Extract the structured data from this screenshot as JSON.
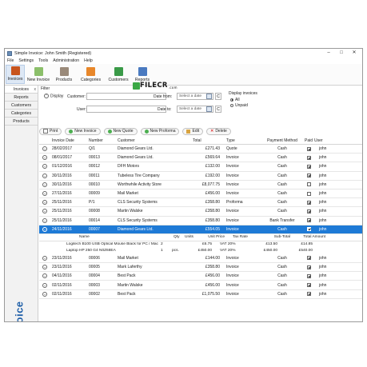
{
  "window": {
    "title": "Simple Invoice: John Smith (Registered)",
    "minimize": "–",
    "maximize": "□",
    "close": "✕"
  },
  "menu": [
    "File",
    "Settings",
    "Tools",
    "Administration",
    "Help"
  ],
  "ribbon": [
    {
      "label": "Invoices",
      "icon": "invoices-icon",
      "color": "#c8551e"
    },
    {
      "label": "New Invoice",
      "icon": "new-invoice-icon",
      "color": "#8bbf6a"
    },
    {
      "label": "Products",
      "icon": "products-icon",
      "color": "#9a8a7a"
    },
    {
      "label": "Categories",
      "icon": "categories-icon",
      "color": "#e8872a"
    },
    {
      "label": "Customers",
      "icon": "customers-icon",
      "color": "#3a9a48"
    },
    {
      "label": "Reports",
      "icon": "reports-icon",
      "color": "#4a7ac0"
    }
  ],
  "watermark": {
    "text": "FILECR",
    "suffix": ".com"
  },
  "sidebar": {
    "items": [
      {
        "label": "Invoices",
        "close": "x"
      },
      {
        "label": "Reports"
      },
      {
        "label": "Customers"
      },
      {
        "label": "Categories"
      },
      {
        "label": "Products"
      }
    ],
    "brand": "Simple Invoice"
  },
  "filter": {
    "heading": "Filter",
    "display_label": "Display",
    "customer_label": "Customer:",
    "user_label": "User:",
    "date_from_label": "Date from:",
    "date_to_label": "Date to:",
    "date_placeholder": "Select a date",
    "clear": "C",
    "display_invoices_label": "Display invoices",
    "option_all": "All",
    "option_unpaid": "Unpaid"
  },
  "toolbar": {
    "print": "Print",
    "new_invoice": "New Invoice",
    "new_quote": "New Quote",
    "new_proforma": "New Proforma",
    "edit": "Edit",
    "delete": "Delete"
  },
  "grid": {
    "columns": [
      "Invoice Date",
      "Number",
      "Customer",
      "Total",
      "Type",
      "Payment Method",
      "Paid",
      "User"
    ],
    "rows_before": [
      {
        "date": "28/02/2017",
        "number": "Q/1",
        "customer": "Diamond Gears Ltd.",
        "total": "£271.43",
        "type": "Quote",
        "payment": "Cash",
        "paid": true,
        "user": "john"
      },
      {
        "date": "08/01/2017",
        "number": "00013",
        "customer": "Diamond Gears Ltd.",
        "total": "£569.64",
        "type": "Invoice",
        "payment": "Cash",
        "paid": true,
        "user": "john"
      },
      {
        "date": "01/12/2016",
        "number": "00012",
        "customer": "DFH Motors",
        "total": "£132.00",
        "type": "Invoice",
        "payment": "Cash",
        "paid": true,
        "user": "john"
      },
      {
        "date": "30/11/2016",
        "number": "00011",
        "customer": "Tubeless Tire Company",
        "total": "£192.00",
        "type": "Invoice",
        "payment": "Cash",
        "paid": true,
        "user": "john"
      },
      {
        "date": "30/11/2016",
        "number": "00010",
        "customer": "Worthwhile Activity Store",
        "total": "£8,077.75",
        "type": "Invoice",
        "payment": "Cash",
        "paid": false,
        "user": "john"
      },
      {
        "date": "27/11/2016",
        "number": "00009",
        "customer": "Mail Market",
        "total": "£456.00",
        "type": "Invoice",
        "payment": "Cash",
        "paid": false,
        "user": "john"
      },
      {
        "date": "25/11/2016",
        "number": "P/1",
        "customer": "CLS Security Systems",
        "total": "£358.80",
        "type": "Proforma",
        "payment": "Cash",
        "paid": true,
        "user": "john"
      },
      {
        "date": "25/11/2016",
        "number": "00008",
        "customer": "Martin Walske",
        "total": "£358.80",
        "type": "Invoice",
        "payment": "Cash",
        "paid": true,
        "user": "john"
      },
      {
        "date": "25/11/2016",
        "number": "00014",
        "customer": "CLS Security Systems",
        "total": "£358.80",
        "type": "Invoice",
        "payment": "Bank Transfer",
        "paid": true,
        "user": "john"
      }
    ],
    "selected_row": {
      "date": "24/11/2016",
      "number": "00007",
      "customer": "Diamond Gears Ltd.",
      "total": "£554.05",
      "type": "Invoice",
      "payment": "Cash",
      "paid": true,
      "user": "john"
    },
    "detail": {
      "columns": [
        "Name",
        "Qty",
        "Units",
        "Unit Price",
        "Tax Rate",
        "Sub-Total",
        "Total Amount"
      ],
      "rows": [
        {
          "name": "Logitech B100 USB Optical Mouse Black for PC / Mac",
          "qty": "2",
          "units": "",
          "unit_price": "£6.75",
          "tax": "VAT 20%",
          "subtotal": "£13.50",
          "total": "£14.85"
        },
        {
          "name": "Laptop HP 250 G4 N0Z68EA",
          "qty": "1",
          "units": "pcs.",
          "unit_price": "£450.00",
          "tax": "VAT 20%",
          "subtotal": "£450.00",
          "total": "£540.00"
        }
      ]
    },
    "rows_after": [
      {
        "date": "23/11/2016",
        "number": "00006",
        "customer": "Mail Market",
        "total": "£144.00",
        "type": "Invoice",
        "payment": "Cash",
        "paid": true,
        "user": "john"
      },
      {
        "date": "23/11/2016",
        "number": "00005",
        "customer": "Mark Laferthy",
        "total": "£358.80",
        "type": "Invoice",
        "payment": "Cash",
        "paid": true,
        "user": "john"
      },
      {
        "date": "04/11/2016",
        "number": "00004",
        "customer": "Best Pack",
        "total": "£456.00",
        "type": "Invoice",
        "payment": "Cash",
        "paid": true,
        "user": "john"
      },
      {
        "date": "02/11/2016",
        "number": "00003",
        "customer": "Martin Walske",
        "total": "£456.00",
        "type": "Invoice",
        "payment": "Cash",
        "paid": true,
        "user": "john"
      },
      {
        "date": "02/11/2016",
        "number": "00002",
        "customer": "Best Pack",
        "total": "£1,075.50",
        "type": "Invoice",
        "payment": "Cash",
        "paid": true,
        "user": "john"
      }
    ]
  },
  "colors": {
    "accent": "#1e7ad6",
    "brand": "#1f5fa8",
    "sidebar_bg": "#f2f2f2"
  }
}
